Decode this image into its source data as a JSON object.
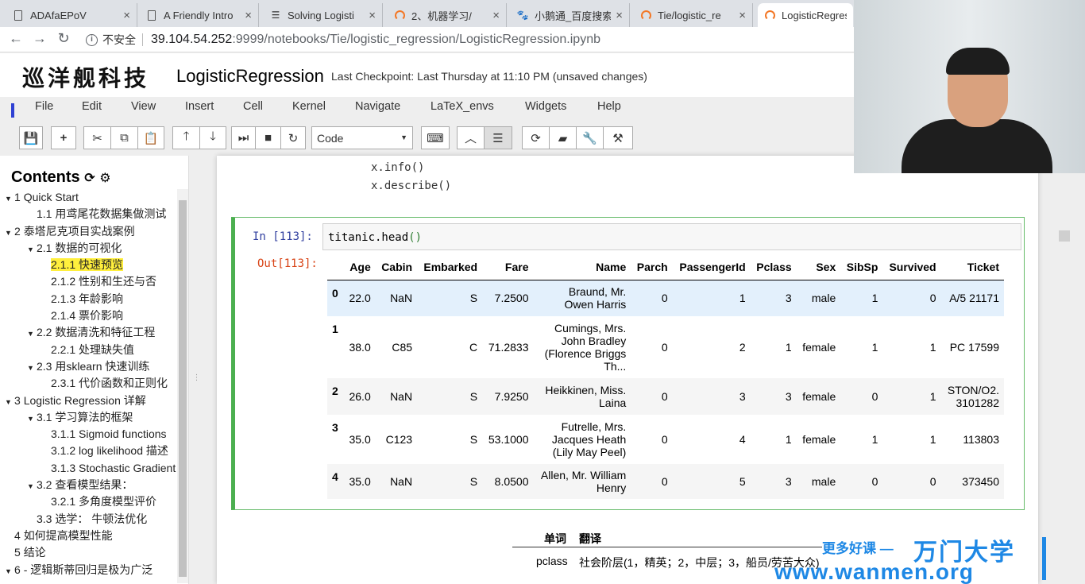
{
  "browser": {
    "tabs": [
      {
        "title": "ADAfaEPoV",
        "icon": "document-icon"
      },
      {
        "title": "A Friendly Intro",
        "icon": "document-icon"
      },
      {
        "title": "Solving Logisti",
        "icon": "menu-icon"
      },
      {
        "title": "2、机器学习/",
        "icon": "jupyter-icon"
      },
      {
        "title": "小鹅通_百度搜索",
        "icon": "paw-icon"
      },
      {
        "title": "Tie/logistic_re",
        "icon": "jupyter-icon"
      },
      {
        "title": "LogisticRegres",
        "icon": "jupyter-icon"
      }
    ],
    "insecure_label": "不安全",
    "url_host": "39.104.54.252",
    "url_rest": ":9999/notebooks/Tie/logistic_regression/LogisticRegression.ipynb"
  },
  "header": {
    "logo": "巡洋舰科技",
    "notebook_title": "LogisticRegression",
    "checkpoint": "Last Checkpoint: Last Thursday at 11:10 PM (unsaved changes)"
  },
  "menu": [
    "File",
    "Edit",
    "View",
    "Insert",
    "Cell",
    "Kernel",
    "Navigate",
    "LaTeX_envs",
    "Widgets",
    "Help"
  ],
  "toolbar": {
    "cell_type": "Code"
  },
  "toc": {
    "title": "Contents",
    "items": [
      {
        "num": "1",
        "text": "Quick Start",
        "level": 0,
        "toggle": "▼"
      },
      {
        "num": "1.1",
        "text": "用鸢尾花数据集做测试",
        "level": 1,
        "toggle": ""
      },
      {
        "num": "2",
        "text": "泰塔尼克项目实战案例",
        "level": 0,
        "toggle": "▼"
      },
      {
        "num": "2.1",
        "text": "数据的可视化",
        "level": 1,
        "toggle": "▼"
      },
      {
        "num": "2.1.1",
        "text": "快速预览",
        "level": 2,
        "toggle": "",
        "highlight": true
      },
      {
        "num": "2.1.2",
        "text": "性别和生还与否",
        "level": 2,
        "toggle": ""
      },
      {
        "num": "2.1.3",
        "text": "年龄影响",
        "level": 2,
        "toggle": ""
      },
      {
        "num": "2.1.4",
        "text": "票价影响",
        "level": 2,
        "toggle": ""
      },
      {
        "num": "2.2",
        "text": "数据清洗和特征工程",
        "level": 1,
        "toggle": "▼"
      },
      {
        "num": "2.2.1",
        "text": "处理缺失值",
        "level": 2,
        "toggle": ""
      },
      {
        "num": "2.3",
        "text": "用sklearn 快速训练",
        "level": 1,
        "toggle": "▼"
      },
      {
        "num": "2.3.1",
        "text": "代价函数和正则化",
        "level": 2,
        "toggle": ""
      },
      {
        "num": "3",
        "text": "Logistic Regression 详解",
        "level": 0,
        "toggle": "▼"
      },
      {
        "num": "3.1",
        "text": "学习算法的框架",
        "level": 1,
        "toggle": "▼"
      },
      {
        "num": "3.1.1",
        "text": "Sigmoid functions",
        "level": 2,
        "toggle": ""
      },
      {
        "num": "3.1.2",
        "text": "log likelihood 描述",
        "level": 2,
        "toggle": ""
      },
      {
        "num": "3.1.3",
        "text": "Stochastic Gradient",
        "level": 2,
        "toggle": ""
      },
      {
        "num": "3.2",
        "text": "查看模型结果：",
        "level": 1,
        "toggle": "▼"
      },
      {
        "num": "3.2.1",
        "text": "多角度模型评价",
        "level": 2,
        "toggle": ""
      },
      {
        "num": "3.3",
        "text": "选学： 牛顿法优化",
        "level": 1,
        "toggle": ""
      },
      {
        "num": "4",
        "text": "如何提高模型性能",
        "level": 0,
        "toggle": ""
      },
      {
        "num": "5",
        "text": "结论",
        "level": 0,
        "toggle": ""
      },
      {
        "num": "6",
        "text": "- 逻辑斯蒂回归是极为广泛",
        "level": 0,
        "toggle": "▼"
      }
    ]
  },
  "prev_code": [
    "x.info()",
    "x.describe()"
  ],
  "cell": {
    "in_prompt": "In  [113]:",
    "code_prefix": "titanic.head",
    "code_paren": "()",
    "out_prompt": "Out[113]:"
  },
  "dataframe": {
    "columns": [
      "",
      "Age",
      "Cabin",
      "Embarked",
      "Fare",
      "Name",
      "Parch",
      "PassengerId",
      "Pclass",
      "Sex",
      "SibSp",
      "Survived",
      "Ticket"
    ],
    "rows": [
      {
        "idx": "0",
        "Age": "22.0",
        "Cabin": "NaN",
        "Embarked": "S",
        "Fare": "7.2500",
        "Name": [
          "Braund, Mr.",
          "Owen Harris"
        ],
        "Parch": "0",
        "PassengerId": "1",
        "Pclass": "3",
        "Sex": "male",
        "SibSp": "1",
        "Survived": "0",
        "Ticket": [
          "A/5 21171"
        ]
      },
      {
        "idx": "1",
        "Age": "38.0",
        "Cabin": "C85",
        "Embarked": "C",
        "Fare": "71.2833",
        "Name": [
          "Cumings, Mrs.",
          "John Bradley",
          "(Florence Briggs",
          "Th..."
        ],
        "Parch": "0",
        "PassengerId": "2",
        "Pclass": "1",
        "Sex": "female",
        "SibSp": "1",
        "Survived": "1",
        "Ticket": [
          "PC 17599"
        ]
      },
      {
        "idx": "2",
        "Age": "26.0",
        "Cabin": "NaN",
        "Embarked": "S",
        "Fare": "7.9250",
        "Name": [
          "Heikkinen, Miss.",
          "Laina"
        ],
        "Parch": "0",
        "PassengerId": "3",
        "Pclass": "3",
        "Sex": "female",
        "SibSp": "0",
        "Survived": "1",
        "Ticket": [
          "STON/O2.",
          "3101282"
        ]
      },
      {
        "idx": "3",
        "Age": "35.0",
        "Cabin": "C123",
        "Embarked": "S",
        "Fare": "53.1000",
        "Name": [
          "Futrelle, Mrs.",
          "Jacques Heath",
          "(Lily May Peel)"
        ],
        "Parch": "0",
        "PassengerId": "4",
        "Pclass": "1",
        "Sex": "female",
        "SibSp": "1",
        "Survived": "1",
        "Ticket": [
          "113803"
        ]
      },
      {
        "idx": "4",
        "Age": "35.0",
        "Cabin": "NaN",
        "Embarked": "S",
        "Fare": "8.0500",
        "Name": [
          "Allen, Mr. William",
          "Henry"
        ],
        "Parch": "0",
        "PassengerId": "5",
        "Pclass": "3",
        "Sex": "male",
        "SibSp": "0",
        "Survived": "0",
        "Ticket": [
          "373450"
        ]
      }
    ]
  },
  "glossary": {
    "col_word": "单词",
    "col_translation": "翻译",
    "rows": [
      {
        "word": "pclass",
        "translation": "社会阶层(1，精英；2，中层；3，船员/劳苦大众)"
      }
    ]
  },
  "watermark": {
    "tagline": "更多好课 —",
    "brand": "万门大学",
    "url": "www.wanmen.org"
  },
  "colors": {
    "cell_border": "#4caf50",
    "toc_highlight": "#ffef3d",
    "in_prompt": "#303f9f",
    "out_prompt": "#d84315",
    "watermark": "#1e88e5"
  }
}
